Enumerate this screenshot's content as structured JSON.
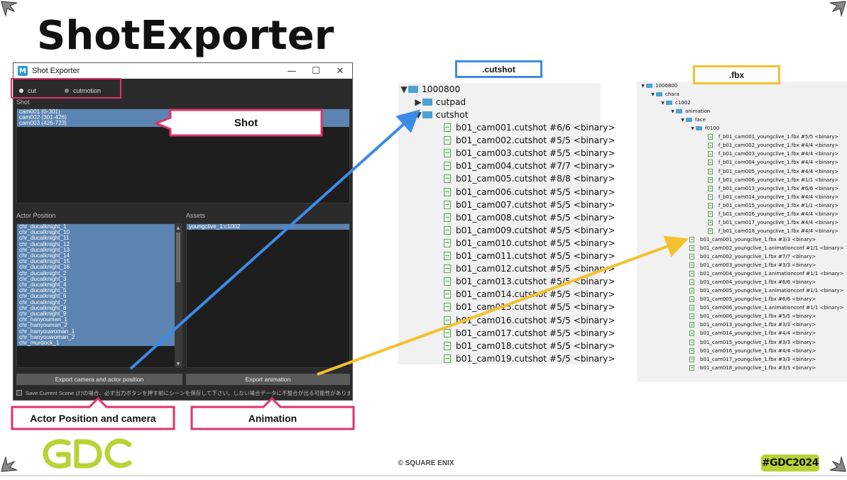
{
  "slide": {
    "title": "ShotExporter",
    "copyright": "© SQUARE ENIX",
    "tag": "#GDC2024"
  },
  "window": {
    "title": "Shot Exporter",
    "controls": {
      "minimize": "—",
      "maximize": "☐",
      "close": "✕"
    },
    "mode": {
      "options": [
        {
          "label": "cut",
          "selected": true
        },
        {
          "label": "cutmotion",
          "selected": false
        }
      ]
    },
    "shot": {
      "label": "Shot",
      "items": [
        "cam001 (0-301)",
        "cam002 (301-426)",
        "cam003 (426-723)"
      ]
    },
    "actor_position": {
      "label": "Actor Position",
      "items": [
        "chr_ducalknight_1",
        "chr_ducalknight_10",
        "chr_ducalknight_11",
        "chr_ducalknight_12",
        "chr_ducalknight_13",
        "chr_ducalknight_14",
        "chr_ducalknight_15",
        "chr_ducalknight_16",
        "chr_ducalknight_2",
        "chr_ducalknight_3",
        "chr_ducalknight_4",
        "chr_ducalknight_5",
        "chr_ducalknight_6",
        "chr_ducalknight_7",
        "chr_ducalknight_8",
        "chr_ducalknight_9",
        "chr_hanyouman_1",
        "chr_hanyouman_2",
        "chr_hanyouwoman_1",
        "chr_hanyouwoman_2",
        "chr_murdock_1"
      ]
    },
    "assets": {
      "label": "Assets",
      "items": [
        "youngclive_1:c1002"
      ]
    },
    "buttons": {
      "export_camera": "Export camera and actor position",
      "export_animation": "Export animation"
    },
    "save_scene": {
      "label": "Save Current Scene (ｵﾌの場合、必ず出力ボタンを押す前にシーンを保存して下さい。しない場合データに不整合が出る可能性があります。)",
      "checked": false
    }
  },
  "callouts": {
    "shot": "Shot",
    "actor": "Actor Position and camera",
    "animation": "Animation"
  },
  "cutshot_panel": {
    "label": ".cutshot",
    "root": "1000800",
    "folders": [
      "cutpad",
      "cutshot"
    ],
    "files": [
      "b01_cam001.cutshot #6/6 <binary>",
      "b01_cam002.cutshot #5/5 <binary>",
      "b01_cam003.cutshot #5/5 <binary>",
      "b01_cam004.cutshot #7/7 <binary>",
      "b01_cam005.cutshot #8/8 <binary>",
      "b01_cam006.cutshot #5/5 <binary>",
      "b01_cam007.cutshot #5/5 <binary>",
      "b01_cam008.cutshot #5/5 <binary>",
      "b01_cam009.cutshot #5/5 <binary>",
      "b01_cam010.cutshot #5/5 <binary>",
      "b01_cam011.cutshot #5/5 <binary>",
      "b01_cam012.cutshot #5/5 <binary>",
      "b01_cam013.cutshot #5/5 <binary>",
      "b01_cam014.cutshot #5/5 <binary>",
      "b01_cam015.cutshot #5/5 <binary>",
      "b01_cam016.cutshot #5/5 <binary>",
      "b01_cam017.cutshot #5/5 <binary>",
      "b01_cam018.cutshot #5/5 <binary>",
      "b01_cam019.cutshot #5/5 <binary>"
    ]
  },
  "fbx_panel": {
    "label": ".fbx",
    "folders": [
      "1000800",
      "chara",
      "c1002",
      "animation",
      "face",
      "f0100"
    ],
    "face_files": [
      "f_b01_cam001_youngclive_1.fbx #5/5 <binary>",
      "f_b01_cam002_youngclive_1.fbx #4/4 <binary>",
      "f_b01_cam003_youngclive_1.fbx #4/4 <binary>",
      "f_b01_cam004_youngclive_1.fbx #4/4 <binary>",
      "f_b01_cam005_youngclive_1.fbx #4/4 <binary>",
      "f_b01_cam006_youngclive_1.fbx #1/1 <binary>",
      "f_b01_cam013_youngclive_1.fbx #6/6 <binary>",
      "f_b01_cam014_youngclive_1.fbx #4/4 <binary>",
      "f_b01_cam015_youngclive_1.fbx #1/1 <binary>",
      "f_b01_cam016_youngclive_1.fbx #4/4 <binary>",
      "f_b01_cam017_youngclive_1.fbx #4/4 <binary>",
      "f_b01_cam018_youngclive_1.fbx #4/4 <binary>"
    ],
    "anim_files": [
      "b01_cam001_youngclive_1.fbx #3/3 <binary>",
      "b01_cam002_youngclive_1.animationconf #1/1 <binary>",
      "b01_cam002_youngclive_1.fbx #7/7 <binary>",
      "b01_cam003_youngclive_1.fbx #3/3 <binary>",
      "b01_cam004_youngclive_1.animationconf #1/1 <binary>",
      "b01_cam004_youngclive_1.fbx #6/6 <binary>",
      "b01_cam005_youngclive_1.animationconf #1/1 <binary>",
      "b01_cam005_youngclive_1.fbx #6/6 <binary>",
      "b01_cam006_youngclive_1.animationconf #1/1 <binary>",
      "b01_cam006_youngclive_1.fbx #5/5 <binary>",
      "b01_cam013_youngclive_1.fbx #3/3 <binary>",
      "b01_cam014_youngclive_1.fbx #4/4 <binary>",
      "b01_cam015_youngclive_1.fbx #3/3 <binary>",
      "b01_cam016_youngclive_1.fbx #4/4 <binary>",
      "b01_cam017_youngclive_1.fbx #3/3 <binary>",
      "b01_cam018_youngclive_1.fbx #3/3 <binary>"
    ]
  },
  "colors": {
    "callout_border": "#e03368",
    "cutshot_accent": "#3d8be8",
    "fbx_accent": "#f2c12e",
    "selection": "#5b84b1",
    "gdc_green": "#b7d335"
  }
}
